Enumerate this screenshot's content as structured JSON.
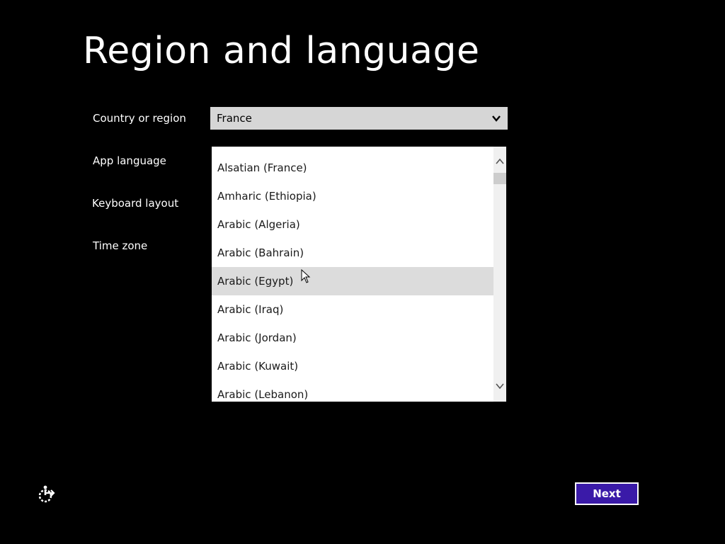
{
  "page": {
    "title": "Region and language"
  },
  "fields": {
    "country_label": "Country or region",
    "app_language_label": "App language",
    "keyboard_layout_label": "Keyboard layout",
    "time_zone_label": "Time zone"
  },
  "country_select": {
    "value": "France",
    "icon": "chevron-down-icon"
  },
  "language_dropdown": {
    "items": [
      "Alsatian (France)",
      "Amharic (Ethiopia)",
      "Arabic (Algeria)",
      "Arabic (Bahrain)",
      "Arabic (Egypt)",
      "Arabic (Iraq)",
      "Arabic (Jordan)",
      "Arabic (Kuwait)",
      "Arabic (Lebanon)"
    ],
    "hovered_index": 4
  },
  "footer": {
    "ease_of_access_icon": "ease-of-access-icon",
    "next_label": "Next"
  },
  "colors": {
    "background": "#000000",
    "accent": "#3a1aa8",
    "select_bg": "#d6d6d6",
    "hover_bg": "#dcdcdc"
  }
}
